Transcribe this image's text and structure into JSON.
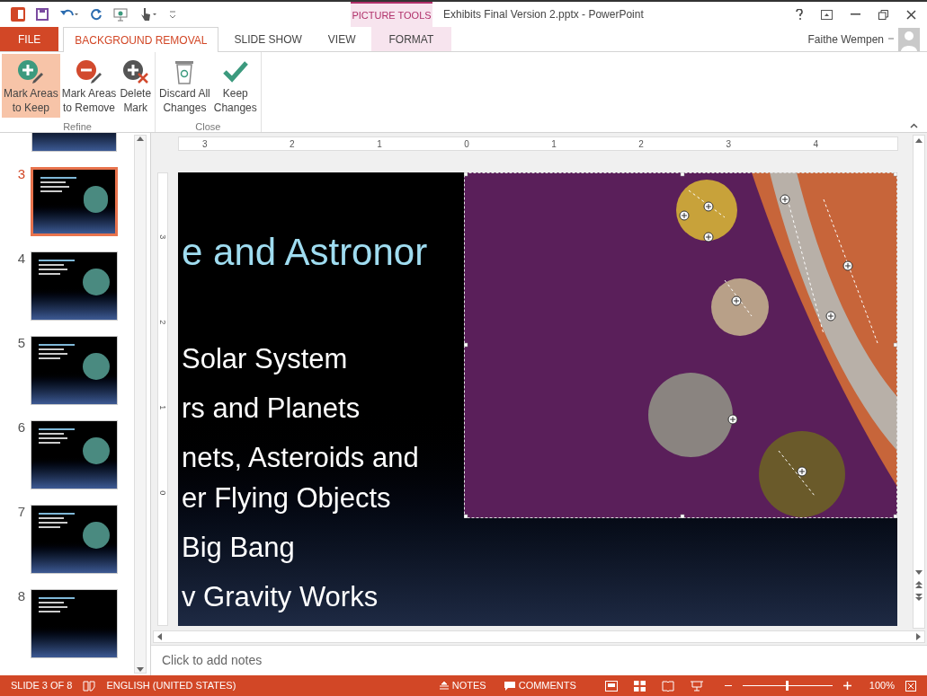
{
  "title_bar": {
    "contextual_group": "PICTURE TOOLS",
    "title": "Exhibits Final Version 2.pptx - PowerPoint"
  },
  "tabs": [
    {
      "label": "FILE",
      "kind": "file",
      "selected": false
    },
    {
      "label": "BACKGROUND REMOVAL",
      "kind": "normal",
      "selected": true
    },
    {
      "label": "SLIDE SHOW",
      "kind": "normal",
      "selected": false
    },
    {
      "label": "VIEW",
      "kind": "normal",
      "selected": false
    },
    {
      "label": "FORMAT",
      "kind": "contextual",
      "selected": false
    }
  ],
  "user": {
    "name": "Faithe Wempen"
  },
  "ribbon": {
    "groups": [
      {
        "label": "Refine",
        "buttons": [
          {
            "lines": [
              "Mark Areas",
              "to Keep"
            ],
            "kind": "keep",
            "selected": true
          },
          {
            "lines": [
              "Mark Areas",
              "to Remove"
            ],
            "kind": "remove",
            "selected": false
          },
          {
            "lines": [
              "Delete",
              "Mark"
            ],
            "kind": "delete",
            "selected": false
          }
        ]
      },
      {
        "label": "Close",
        "buttons": [
          {
            "lines": [
              "Discard All",
              "Changes"
            ],
            "kind": "discard",
            "selected": false
          },
          {
            "lines": [
              "Keep",
              "Changes"
            ],
            "kind": "check",
            "selected": false
          }
        ]
      }
    ]
  },
  "slides": [
    {
      "number": "3",
      "selected": true,
      "has_picture": true
    },
    {
      "number": "4",
      "selected": false,
      "has_picture": true
    },
    {
      "number": "5",
      "selected": false,
      "has_picture": true
    },
    {
      "number": "6",
      "selected": false,
      "has_picture": true
    },
    {
      "number": "7",
      "selected": false,
      "has_picture": true
    },
    {
      "number": "8",
      "selected": false,
      "has_picture": false
    }
  ],
  "ruler": {
    "horizontal": [
      "3",
      "2",
      "1",
      "0",
      "1",
      "2",
      "3",
      "4"
    ],
    "vertical": [
      "3",
      "2",
      "1",
      "0"
    ]
  },
  "slide": {
    "title": "e and Astronor",
    "bullets": [
      {
        "lines": [
          "Solar System"
        ]
      },
      {
        "lines": [
          "rs and Planets"
        ]
      },
      {
        "lines": [
          "nets, Asteroids and",
          "er Flying Objects"
        ]
      },
      {
        "lines": [
          "Big Bang"
        ]
      },
      {
        "lines": [
          "v Gravity Works"
        ]
      }
    ]
  },
  "notes_placeholder": "Click to add notes",
  "status_bar": {
    "slide_info": "SLIDE 3 OF 8",
    "language": "ENGLISH (UNITED STATES)",
    "notes": "NOTES",
    "comments": "COMMENTS",
    "zoom_slider": {
      "level": 0.48
    },
    "zoom": "100%"
  }
}
